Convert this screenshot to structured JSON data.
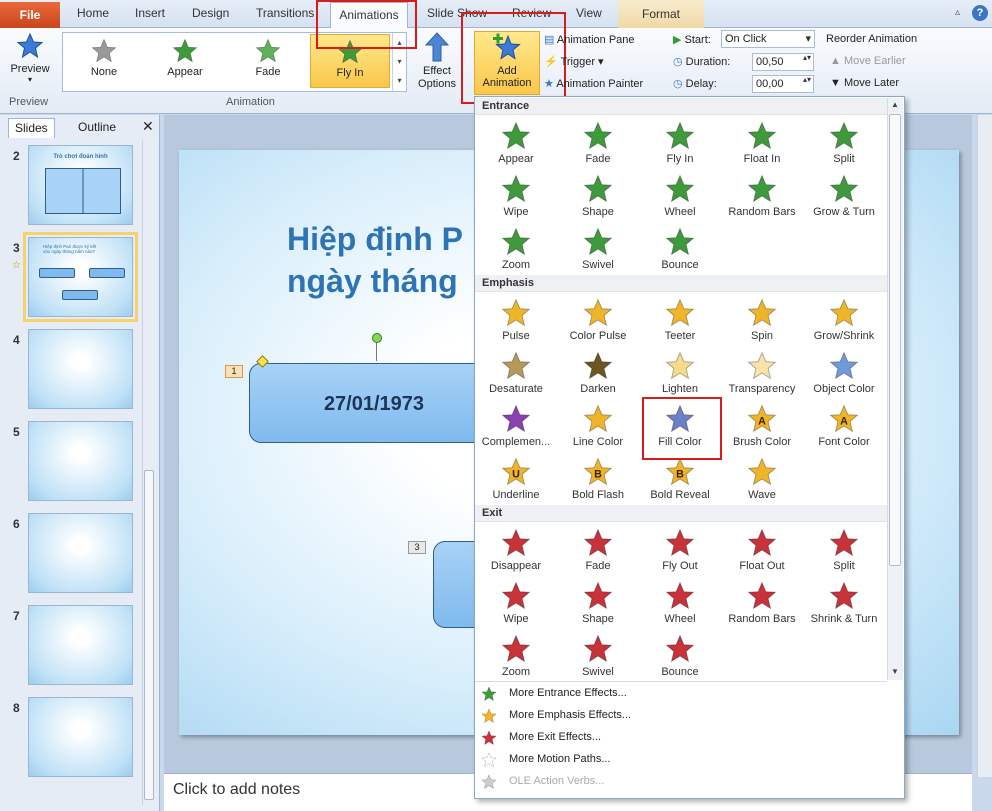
{
  "tabs": {
    "file": "File",
    "home": "Home",
    "insert": "Insert",
    "design": "Design",
    "transitions": "Transitions",
    "animations": "Animations",
    "slideshow": "Slide Show",
    "review": "Review",
    "view": "View",
    "format": "Format"
  },
  "ribbon": {
    "preview_label": "Preview",
    "preview_group": "Preview",
    "gallery": [
      "None",
      "Appear",
      "Fade",
      "Fly In"
    ],
    "animation_group": "Animation",
    "effect_options": "Effect Options",
    "add_animation_line1": "Add",
    "add_animation_line2": "Animation",
    "animation_pane": "Animation Pane",
    "trigger": "Trigger",
    "animation_painter": "Animation Painter",
    "start_label": "Start:",
    "start_value": "On Click",
    "duration_label": "Duration:",
    "duration_value": "00,50",
    "delay_label": "Delay:",
    "delay_value": "00,00",
    "reorder": "Reorder Animation",
    "move_earlier": "Move Earlier",
    "move_later": "Move Later"
  },
  "panel": {
    "tab_slides": "Slides",
    "tab_outline": "Outline",
    "slide2_title": "Trò chơi đoán hình",
    "slide3_title": "Hiệp định Pari được ký kết vào ngày tháng năm nào?",
    "slide_numbers": [
      "2",
      "3",
      "4",
      "5",
      "6",
      "7",
      "8"
    ]
  },
  "slide": {
    "title_line1": "Hiệp định P",
    "title_line2": "ngày tháng",
    "box1_text": "27/01/1973",
    "tag1": "1",
    "tag3": "3"
  },
  "notes": "Click to add notes",
  "dropdown": {
    "entrance_header": "Entrance",
    "emphasis_header": "Emphasis",
    "exit_header": "Exit",
    "entrance": [
      "Appear",
      "Fade",
      "Fly In",
      "Float In",
      "Split",
      "Wipe",
      "Shape",
      "Wheel",
      "Random Bars",
      "Grow & Turn",
      "Zoom",
      "Swivel",
      "Bounce"
    ],
    "emphasis": [
      "Pulse",
      "Color Pulse",
      "Teeter",
      "Spin",
      "Grow/Shrink",
      "Desaturate",
      "Darken",
      "Lighten",
      "Transparency",
      "Object Color",
      "Complemen...",
      "Line Color",
      "Fill Color",
      "Brush Color",
      "Font Color",
      "Underline",
      "Bold Flash",
      "Bold Reveal",
      "Wave"
    ],
    "exit": [
      "Disappear",
      "Fade",
      "Fly Out",
      "Float Out",
      "Split",
      "Wipe",
      "Shape",
      "Wheel",
      "Random Bars",
      "Shrink & Turn",
      "Zoom",
      "Swivel",
      "Bounce"
    ],
    "more_entrance": "More Entrance Effects...",
    "more_emphasis": "More Emphasis Effects...",
    "more_exit": "More Exit Effects...",
    "more_motion": "More Motion Paths...",
    "ole": "OLE Action Verbs..."
  },
  "colors": {
    "entrance": "#3f9a3b",
    "emphasis": "#f0b429",
    "exit": "#c8323a",
    "highlight": "#d81b1b",
    "title": "#2e74b5"
  }
}
